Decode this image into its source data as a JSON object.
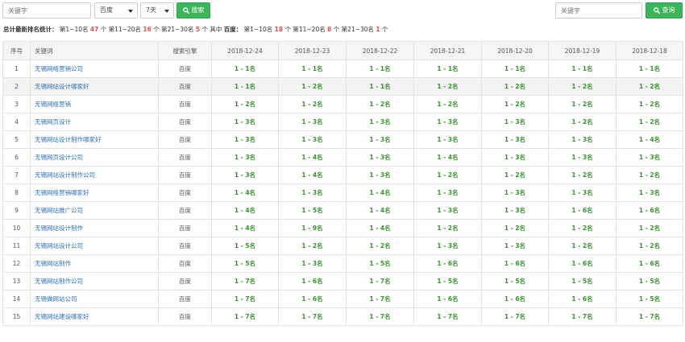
{
  "toolbar": {
    "keyword_placeholder": "关键字",
    "engine_select": "百度",
    "days_select": "7天",
    "search_button": "搜索",
    "query_placeholder": "关键字",
    "query_button": "查询"
  },
  "summary": {
    "label": "总计最新排名统计：",
    "total_top10_text": "第1~10名",
    "total_top10": "47",
    "total_11_20_text": "个 第11~20名",
    "total_11_20": "16",
    "total_21_30_text": "个 第21~30名",
    "total_21_30": "5",
    "baidu_label": "个 其中",
    "baidu_name": "百度：",
    "baidu_top10_text": "第1~10名",
    "baidu_top10": "18",
    "baidu_11_20_text": "个 第11~20名",
    "baidu_11_20": "8",
    "baidu_21_30_text": "个 第21~30名",
    "baidu_21_30": "1",
    "unit": "个"
  },
  "table": {
    "headers": [
      "序号",
      "关键词",
      "搜索引擎",
      "2018-12-24",
      "2018-12-23",
      "2018-12-22",
      "2018-12-21",
      "2018-12-20",
      "2018-12-19",
      "2018-12-18"
    ],
    "rows": [
      {
        "idx": "1",
        "kw": "无锡网络营销公司",
        "engine": "百度",
        "ranks": [
          "1 - 1名",
          "1 - 1名",
          "1 - 1名",
          "1 - 1名",
          "1 - 1名",
          "1 - 1名",
          "1 - 1名"
        ]
      },
      {
        "idx": "2",
        "kw": "无锡网站设计哪家好",
        "engine": "百度",
        "ranks": [
          "1 - 1名",
          "1 - 2名",
          "1 - 1名",
          "1 - 2名",
          "1 - 2名",
          "1 - 2名",
          "1 - 2名"
        ]
      },
      {
        "idx": "3",
        "kw": "无锡网络营销",
        "engine": "百度",
        "ranks": [
          "1 - 2名",
          "1 - 2名",
          "1 - 2名",
          "1 - 2名",
          "1 - 2名",
          "1 - 2名",
          "1 - 2名"
        ]
      },
      {
        "idx": "4",
        "kw": "无锡网页设计",
        "engine": "百度",
        "ranks": [
          "1 - 3名",
          "1 - 3名",
          "1 - 3名",
          "1 - 3名",
          "1 - 3名",
          "1 - 2名",
          "1 - 2名"
        ]
      },
      {
        "idx": "5",
        "kw": "无锡网站设计制作哪家好",
        "engine": "百度",
        "ranks": [
          "1 - 3名",
          "1 - 3名",
          "1 - 3名",
          "1 - 3名",
          "1 - 3名",
          "1 - 3名",
          "1 - 4名"
        ]
      },
      {
        "idx": "6",
        "kw": "无锡网页设计公司",
        "engine": "百度",
        "ranks": [
          "1 - 3名",
          "1 - 4名",
          "1 - 3名",
          "1 - 4名",
          "1 - 3名",
          "1 - 3名",
          "1 - 3名"
        ]
      },
      {
        "idx": "7",
        "kw": "无锡网站设计制作公司",
        "engine": "百度",
        "ranks": [
          "1 - 3名",
          "1 - 4名",
          "1 - 3名",
          "1 - 2名",
          "1 - 2名",
          "1 - 2名",
          "1 - 2名"
        ]
      },
      {
        "idx": "8",
        "kw": "无锡网络营销哪家好",
        "engine": "百度",
        "ranks": [
          "1 - 4名",
          "1 - 3名",
          "1 - 4名",
          "1 - 3名",
          "1 - 3名",
          "1 - 3名",
          "1 - 3名"
        ]
      },
      {
        "idx": "9",
        "kw": "无锡网站推广公司",
        "engine": "百度",
        "ranks": [
          "1 - 4名",
          "1 - 5名",
          "1 - 4名",
          "1 - 3名",
          "1 - 3名",
          "1 - 6名",
          "1 - 6名"
        ]
      },
      {
        "idx": "10",
        "kw": "无锡网站设计制作",
        "engine": "百度",
        "ranks": [
          "1 - 4名",
          "1 - 9名",
          "1 - 4名",
          "1 - 2名",
          "1 - 2名",
          "1 - 2名",
          "1 - 2名"
        ]
      },
      {
        "idx": "11",
        "kw": "无锡网站设计公司",
        "engine": "百度",
        "ranks": [
          "1 - 5名",
          "1 - 2名",
          "1 - 2名",
          "1 - 3名",
          "1 - 3名",
          "1 - 2名",
          "1 - 2名"
        ]
      },
      {
        "idx": "12",
        "kw": "无锡网站制作",
        "engine": "百度",
        "ranks": [
          "1 - 5名",
          "1 - 3名",
          "1 - 5名",
          "1 - 6名",
          "1 - 6名",
          "1 - 6名",
          "1 - 6名"
        ]
      },
      {
        "idx": "13",
        "kw": "无锡网站制作公司",
        "engine": "百度",
        "ranks": [
          "1 - 7名",
          "1 - 6名",
          "1 - 7名",
          "1 - 5名",
          "1 - 5名",
          "1 - 5名",
          "1 - 5名"
        ]
      },
      {
        "idx": "14",
        "kw": "无锡做网站公司",
        "engine": "百度",
        "ranks": [
          "1 - 7名",
          "1 - 6名",
          "1 - 7名",
          "1 - 6名",
          "1 - 6名",
          "1 - 6名",
          "1 - 5名"
        ]
      },
      {
        "idx": "15",
        "kw": "无锡网站建设哪家好",
        "engine": "百度",
        "ranks": [
          "1 - 7名",
          "1 - 7名",
          "1 - 7名",
          "1 - 7名",
          "1 - 7名",
          "1 - 7名",
          "1 - 7名"
        ]
      }
    ]
  },
  "colors": {
    "accent_green": "#3cb55b",
    "keyword_blue": "#2f6fb0",
    "rank_green": "#3c8f32",
    "count_red": "#d9534f"
  }
}
